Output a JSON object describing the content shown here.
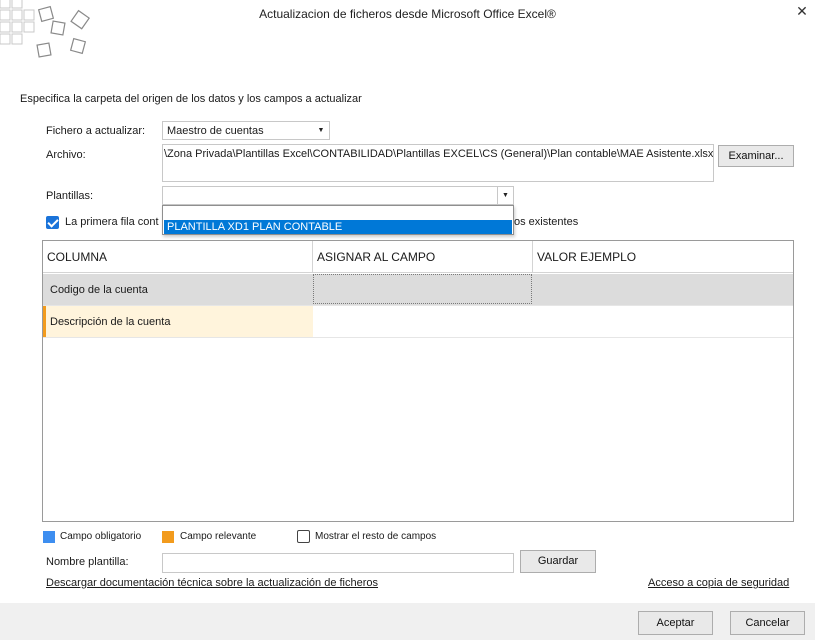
{
  "window": {
    "title": "Actualizacion de ficheros desde Microsoft Office Excel®",
    "close_glyph": "✕"
  },
  "instructions": "Especifica la carpeta del origen de los datos y los campos a actualizar",
  "fichero": {
    "label": "Fichero a actualizar:",
    "value": "Maestro de cuentas"
  },
  "archivo": {
    "label": "Archivo:",
    "path": "\\Zona Privada\\Plantillas Excel\\CONTABILIDAD\\Plantillas EXCEL\\CS (General)\\Plan contable\\MAE Asistente.xlsx",
    "browse_label": "Examinar..."
  },
  "plantillas": {
    "label": "Plantillas:",
    "value": "",
    "options": [
      "PLANTILLA XD1 PLAN CONTABLE"
    ]
  },
  "first_row_checkbox": {
    "checked": true,
    "label_left": "La primera fila cont",
    "label_right": "os existentes"
  },
  "grid": {
    "columns": [
      "COLUMNA",
      "ASIGNAR AL CAMPO",
      "VALOR EJEMPLO"
    ],
    "rows": [
      {
        "columna": "Codigo de la cuenta",
        "asignar": "",
        "valor": "",
        "kind": "obligatorio"
      },
      {
        "columna": "Descripción de la cuenta",
        "asignar": "",
        "valor": "",
        "kind": "relevante"
      }
    ]
  },
  "legend": {
    "obligatorio": {
      "label": "Campo obligatorio",
      "color": "#3d8ef0"
    },
    "relevante": {
      "label": "Campo relevante",
      "color": "#f29b1d"
    },
    "mostrar_resto": {
      "label": "Mostrar el resto de campos",
      "checked": false
    }
  },
  "nombre_plantilla": {
    "label": "Nombre plantilla:",
    "value": "",
    "save_label": "Guardar"
  },
  "links": {
    "doc": "Descargar documentación técnica sobre la actualización de ficheros",
    "backup": "Acceso a copia de seguridad"
  },
  "footer": {
    "accept_label": "Aceptar",
    "cancel_label": "Cancelar"
  },
  "colors": {
    "selection_blue": "#0078d7",
    "row_selected_bg": "#dcdcdc",
    "row_relevant_bg": "#fff4dc",
    "row_relevant_marker": "#f29b1d"
  }
}
